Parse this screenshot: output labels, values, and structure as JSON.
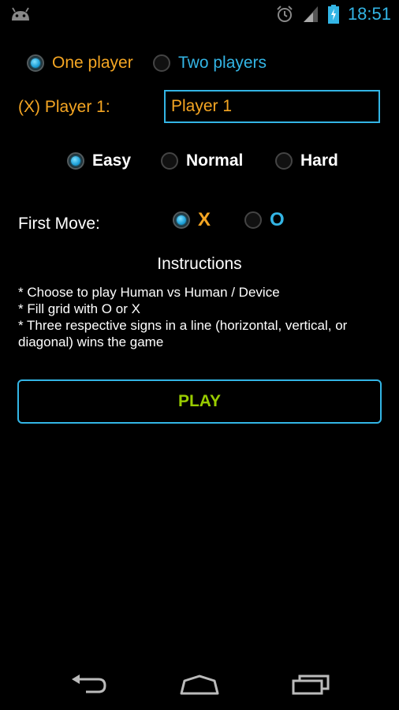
{
  "status_bar": {
    "time": "18:51",
    "icons": [
      "android-icon",
      "alarm-icon",
      "signal-icon",
      "battery-charging-icon"
    ]
  },
  "mode": {
    "options": [
      {
        "label": "One player",
        "checked": true
      },
      {
        "label": "Two players",
        "checked": false
      }
    ]
  },
  "player1": {
    "label": "(X) Player 1:",
    "value": "Player 1"
  },
  "difficulty": {
    "options": [
      {
        "label": "Easy",
        "checked": true
      },
      {
        "label": "Normal",
        "checked": false
      },
      {
        "label": "Hard",
        "checked": false
      }
    ]
  },
  "first_move": {
    "label": "First Move:",
    "options": [
      {
        "label": "X",
        "checked": true
      },
      {
        "label": "O",
        "checked": false
      }
    ]
  },
  "instructions": {
    "title": "Instructions",
    "lines": [
      "* Choose to play Human vs Human / Device",
      "* Fill grid with O or X",
      "* Three respective signs in a line (horizontal, vertical, or diagonal) wins the game"
    ]
  },
  "play_button": {
    "label": "PLAY"
  },
  "colors": {
    "accent_blue": "#33b5e5",
    "orange": "#f5a623",
    "play_green": "#99cc00"
  },
  "nav_bar": {
    "icons": [
      "back-icon",
      "home-icon",
      "recents-icon"
    ]
  }
}
